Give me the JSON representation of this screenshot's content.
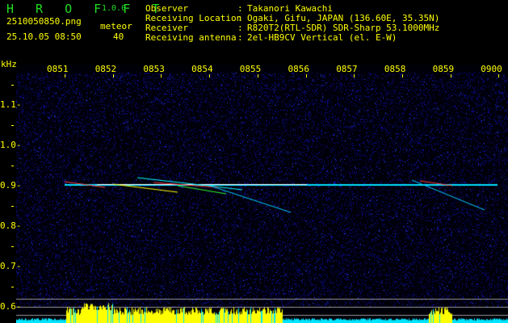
{
  "app": {
    "name": "H R O F F T",
    "version": "1.0.0"
  },
  "file": {
    "name": "2510050850.png",
    "datetime": "25.10.05 08:50"
  },
  "meteor": {
    "label": "meteor",
    "count": "40"
  },
  "info": [
    {
      "label": "Observer",
      "value": "Takanori Kawachi"
    },
    {
      "label": "Receiving Location",
      "value": "Ogaki, Gifu, JAPAN (136.60E, 35.35N)"
    },
    {
      "label": "Receiver",
      "value": "R820T2(RTL-SDR) SDR-Sharp 53.1000MHz"
    },
    {
      "label": "Receiving antenna",
      "value": "2el-HB9CV Vertical (el. E-W)"
    }
  ],
  "axis": {
    "unit": "kHz",
    "time_labels": [
      "0851",
      "0852",
      "0853",
      "0854",
      "0855",
      "0856",
      "0857",
      "0858",
      "0859",
      "0900"
    ],
    "freq_labels": [
      "1.1",
      "1.0",
      "0.9",
      "0.8",
      "0.7",
      "0.6"
    ]
  },
  "colors": {
    "text": "#ffff00",
    "logo": "#22dd22",
    "background_noise": "#0a0a80",
    "carrier": "#00ffff",
    "level_high": "#ffff00",
    "level_low": "#00e5ff"
  }
}
